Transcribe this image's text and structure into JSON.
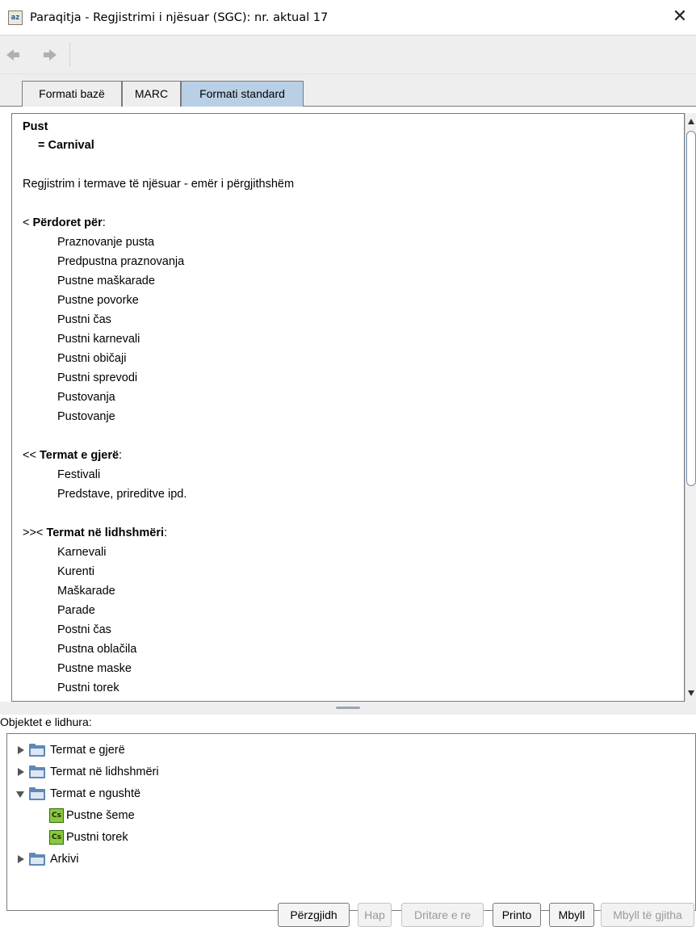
{
  "window": {
    "icon_text": "az",
    "title": "Paraqitja - Regjistrimi i njësuar (SGC): nr. aktual 17",
    "close_glyph": "✕"
  },
  "tabs": [
    {
      "label": "Formati bazë",
      "active": false
    },
    {
      "label": "MARC",
      "active": false
    },
    {
      "label": "Formati standard",
      "active": true
    }
  ],
  "record": {
    "heading": "Pust",
    "equivalent": "= Carnival",
    "description": "Regjistrim i termave të njësuar - emër i përgjithshëm",
    "used_for": {
      "prefix": "< ",
      "label": "Përdoret për",
      "colon": ":",
      "items": [
        "Praznovanje pusta",
        "Predpustna praznovanja",
        "Pustne maškarade",
        "Pustne povorke",
        "Pustni čas",
        "Pustni karnevali",
        "Pustni običaji",
        "Pustni sprevodi",
        "Pustovanja",
        "Pustovanje"
      ]
    },
    "broader": {
      "prefix": "<< ",
      "label": "Termat e gjerë",
      "colon": ":",
      "items": [
        "Festivali",
        "Predstave, prireditve ipd."
      ]
    },
    "related": {
      "prefix": ">>< ",
      "label": "Termat në lidhshmëri",
      "colon": ":",
      "items": [
        "Karnevali",
        "Kurenti",
        "Maškarade",
        "Parade",
        "Postni čas",
        "Pustna oblačila",
        "Pustne maske",
        "Pustni torek"
      ]
    }
  },
  "related_objects": {
    "label": "Objektet e lidhura:",
    "nodes": [
      {
        "label": "Termat e gjerë",
        "expanded": false
      },
      {
        "label": "Termat në lidhshmëri",
        "expanded": false
      },
      {
        "label": "Termat e ngushtë",
        "expanded": true,
        "children": [
          {
            "icon": "Cs",
            "label": "Pustne šeme"
          },
          {
            "icon": "Cs",
            "label": "Pustni torek"
          }
        ]
      },
      {
        "label": "Arkivi",
        "expanded": false
      }
    ]
  },
  "buttons": [
    {
      "label": "Përzgjidh",
      "enabled": true
    },
    {
      "label": "Hap",
      "enabled": false
    },
    {
      "label": "Dritare e re",
      "enabled": false
    },
    {
      "label": "Printo",
      "enabled": true
    },
    {
      "label": "Mbyll",
      "enabled": true
    },
    {
      "label": "Mbyll të gjitha",
      "enabled": false
    }
  ]
}
